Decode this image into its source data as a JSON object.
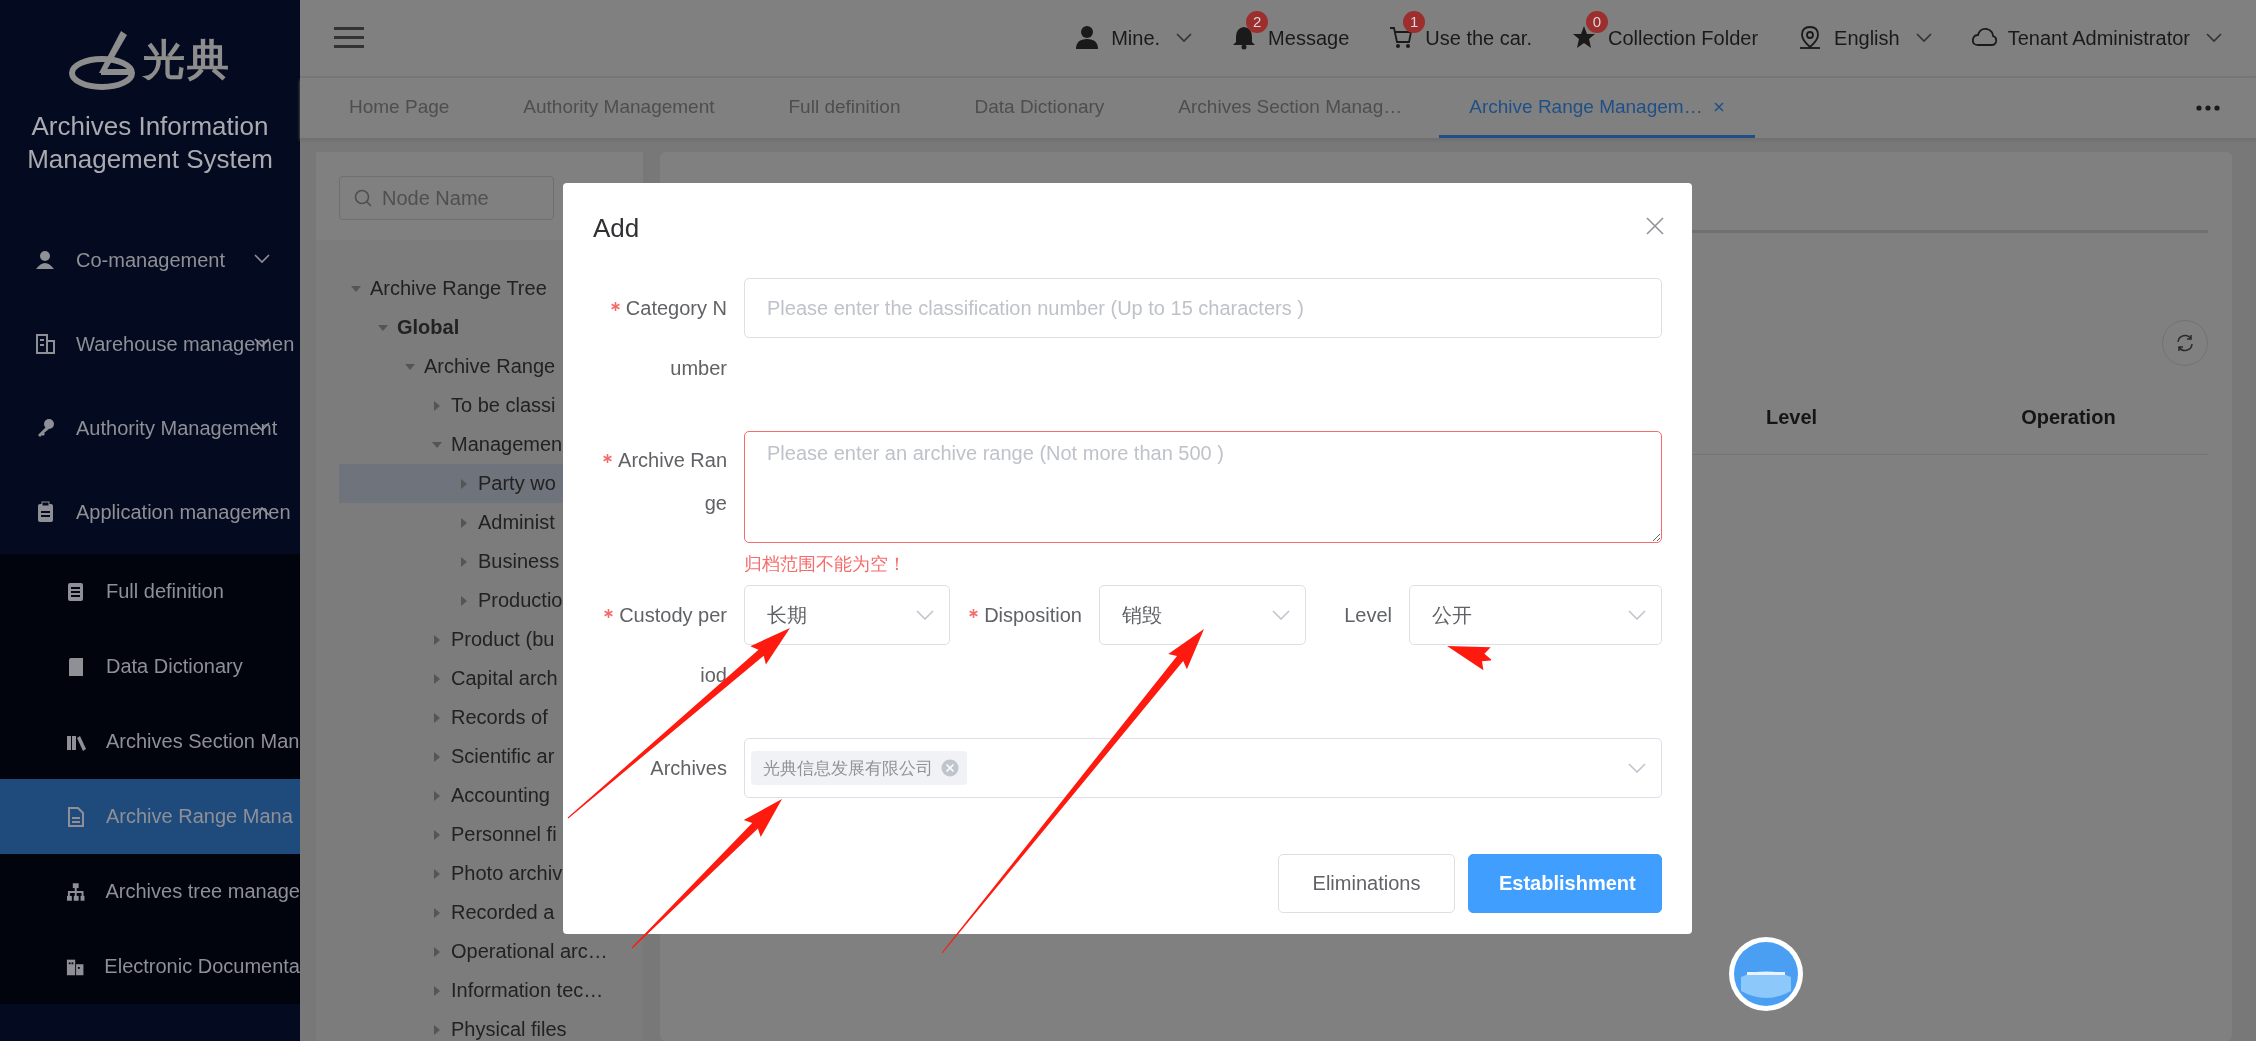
{
  "sidebar": {
    "logo_text": "光典",
    "title": "Archives Information Management System",
    "menu": [
      {
        "label": "Co-management",
        "expanded": false
      },
      {
        "label": "Warehouse managemen",
        "expanded": false
      },
      {
        "label": "Authority Management",
        "expanded": false
      },
      {
        "label": "Application managemen",
        "expanded": true,
        "children": [
          {
            "label": "Full definition",
            "selected": false
          },
          {
            "label": "Data Dictionary",
            "selected": false
          },
          {
            "label": "Archives Section Man",
            "selected": false
          },
          {
            "label": "Archive Range Mana",
            "selected": true
          },
          {
            "label": "Archives tree manage",
            "selected": false
          },
          {
            "label": "Electronic Documenta",
            "selected": false
          }
        ]
      }
    ]
  },
  "toolbar": [
    {
      "kind": "user",
      "label": "Mine.",
      "dropdown": true
    },
    {
      "kind": "bell",
      "label": "Message",
      "badge": "2",
      "dropdown": false
    },
    {
      "kind": "cart",
      "label": "Use the car.",
      "badge": "1",
      "dropdown": false
    },
    {
      "kind": "star",
      "label": "Collection Folder",
      "badge": "0",
      "dropdown": false
    },
    {
      "kind": "location",
      "label": "English",
      "dropdown": true
    },
    {
      "kind": "cloud",
      "label": "Tenant Administrator",
      "dropdown": true
    }
  ],
  "tabs": [
    {
      "label": "Home Page",
      "selected": false
    },
    {
      "label": "Authority Management",
      "selected": false
    },
    {
      "label": "Full definition",
      "selected": false
    },
    {
      "label": "Data Dictionary",
      "selected": false
    },
    {
      "label": "Archives Section Manag…",
      "selected": false
    },
    {
      "label": "Archive Range Managem…",
      "selected": true
    }
  ],
  "tree_panel": {
    "search": {
      "placeholder": "Node Name"
    },
    "tree": [
      {
        "label": "Archive Range Tree",
        "expanded": true,
        "selected": false,
        "children": [
          {
            "label": "Global",
            "bold": true,
            "expanded": true,
            "selected": false,
            "children": [
              {
                "label": "Archive Range",
                "expanded": true,
                "selected": false,
                "children": [
                  {
                    "label": "To be classi",
                    "expanded": false,
                    "selected": false
                  },
                  {
                    "label": "Managemen",
                    "expanded": true,
                    "selected": false,
                    "children": [
                      {
                        "label": "Party wo",
                        "expanded": false,
                        "selected": true
                      },
                      {
                        "label": "Administ",
                        "expanded": false,
                        "selected": false
                      },
                      {
                        "label": "Business",
                        "expanded": false,
                        "selected": false
                      },
                      {
                        "label": "Productio",
                        "expanded": false,
                        "selected": false
                      }
                    ]
                  },
                  {
                    "label": "Product (bu",
                    "expanded": false,
                    "selected": false
                  },
                  {
                    "label": "Capital arch",
                    "expanded": false,
                    "selected": false
                  },
                  {
                    "label": "Records of",
                    "expanded": false,
                    "selected": false
                  },
                  {
                    "label": "Scientific ar",
                    "expanded": false,
                    "selected": false
                  },
                  {
                    "label": "Accounting",
                    "expanded": false,
                    "selected": false
                  },
                  {
                    "label": "Personnel fi",
                    "expanded": false,
                    "selected": false
                  },
                  {
                    "label": "Photo archiv",
                    "expanded": false,
                    "selected": false
                  },
                  {
                    "label": "Recorded a",
                    "expanded": false,
                    "selected": false
                  },
                  {
                    "label": "Operational arc…",
                    "expanded": false,
                    "selected": false
                  },
                  {
                    "label": "Information tec…",
                    "expanded": false,
                    "selected": false
                  },
                  {
                    "label": "Physical files",
                    "expanded": false,
                    "selected": false
                  }
                ]
              }
            ]
          }
        ]
      }
    ]
  },
  "table": {
    "columns": [
      "Level",
      "Operation"
    ]
  },
  "dialog": {
    "title": "Add",
    "fields": [
      {
        "kind": "input",
        "label": "Category Number",
        "required": true,
        "placeholder": "Please enter the classification number (Up to 15 characters )"
      },
      {
        "kind": "textarea",
        "label": "Archive Range",
        "required": true,
        "placeholder": "Please enter an archive range (Not more than 500 )",
        "error": "归档范围不能为空！"
      },
      {
        "kind": "selects",
        "items": [
          {
            "label": "Custody period",
            "required": true,
            "value": "长期"
          },
          {
            "label": "Disposition",
            "required": true,
            "value": "销毁"
          },
          {
            "label": "Level",
            "required": false,
            "value": "公开"
          }
        ]
      },
      {
        "kind": "tags",
        "label": "Archives",
        "required": false,
        "tags": [
          "光典信息发展有限公司"
        ]
      }
    ],
    "buttons": [
      {
        "label": "Eliminations",
        "kind": "default"
      },
      {
        "label": "Establishment",
        "kind": "primary"
      }
    ]
  }
}
